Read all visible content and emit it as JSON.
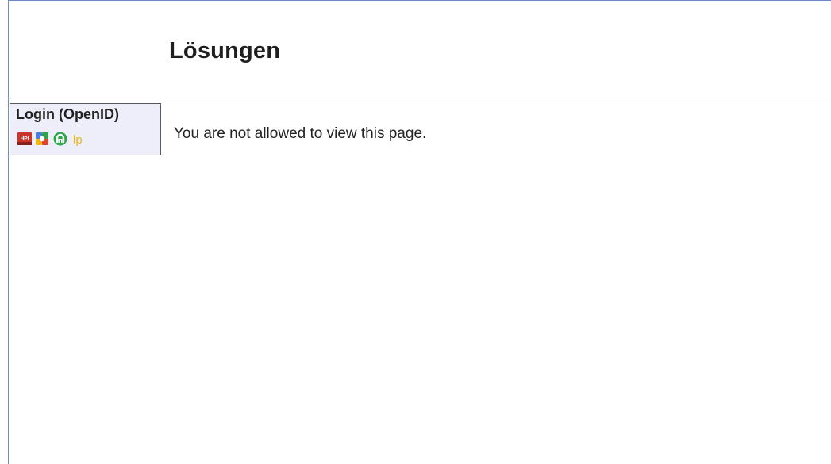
{
  "page": {
    "title": "Lösungen",
    "message": "You are not allowed to view this page."
  },
  "login": {
    "title": "Login (OpenID)",
    "providers": [
      {
        "name": "hpi",
        "label": "HPI"
      },
      {
        "name": "google",
        "label": ""
      },
      {
        "name": "openid",
        "label": ""
      },
      {
        "name": "launchpad",
        "label": "lp"
      }
    ]
  },
  "colors": {
    "frame_border": "#6b8bc4",
    "login_bg": "#eeeefb",
    "hpi_red": "#c8352b",
    "launchpad_yellow": "#e9b618",
    "openid_green": "#2ca84a"
  }
}
